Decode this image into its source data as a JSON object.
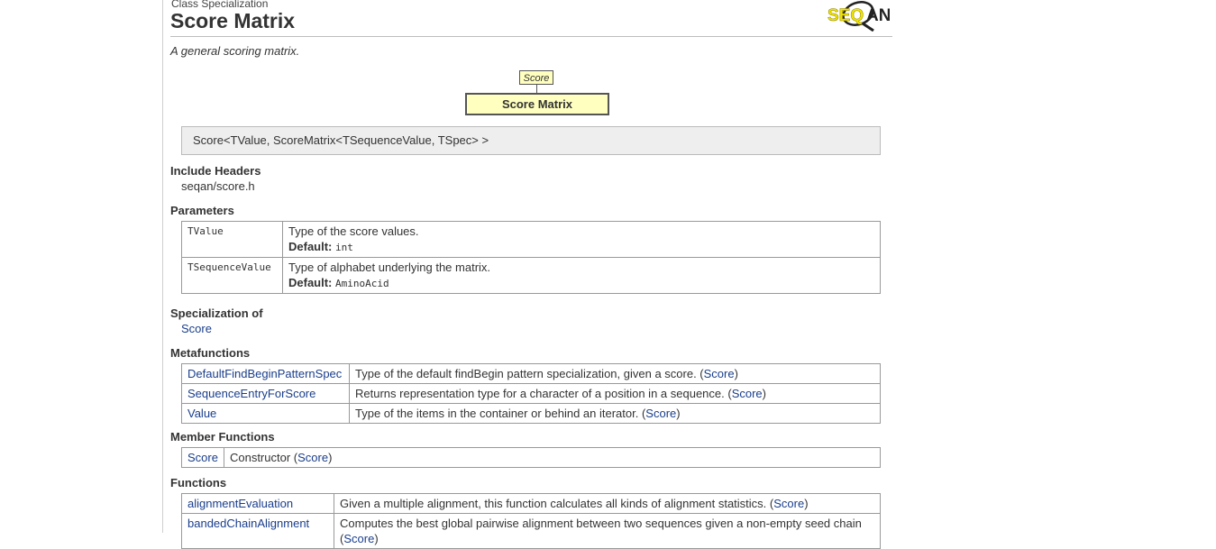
{
  "header": {
    "kind": "Class Specialization",
    "title": "Score Matrix",
    "logo_text": "SEQAN",
    "summary": "A general scoring matrix."
  },
  "diagram": {
    "parent": "Score",
    "current": "Score Matrix"
  },
  "signature": "Score<TValue, ScoreMatrix<TSequenceValue, TSpec> >",
  "include_headers": {
    "heading": "Include Headers",
    "items": [
      "seqan/score.h"
    ]
  },
  "parameters": {
    "heading": "Parameters",
    "default_label": "Default:",
    "rows": [
      {
        "name": "TValue",
        "desc": "Type of the score values.",
        "default": "int"
      },
      {
        "name": "TSequenceValue",
        "desc": "Type of alphabet underlying the matrix.",
        "default": "AminoAcid"
      }
    ]
  },
  "specialization_of": {
    "heading": "Specialization of",
    "link": "Score"
  },
  "metafunctions": {
    "heading": "Metafunctions",
    "rows": [
      {
        "name": "DefaultFindBeginPatternSpec",
        "desc": "Type of the default findBegin pattern specialization, given a score. (",
        "ref": "Score",
        "close": ")"
      },
      {
        "name": "SequenceEntryForScore",
        "desc": "Returns representation type for a character of a position in a sequence. (",
        "ref": "Score",
        "close": ")"
      },
      {
        "name": "Value",
        "desc": "Type of the items in the container or behind an iterator. (",
        "ref": "Score",
        "close": ")"
      }
    ]
  },
  "member_functions": {
    "heading": "Member Functions",
    "rows": [
      {
        "name": "Score",
        "desc": "Constructor (",
        "ref": "Score",
        "close": ")"
      }
    ]
  },
  "functions": {
    "heading": "Functions",
    "rows": [
      {
        "name": "alignmentEvaluation",
        "desc": "Given a multiple alignment, this function calculates all kinds of alignment statistics. (",
        "ref": "Score",
        "close": ")"
      },
      {
        "name": "bandedChainAlignment",
        "desc": "Computes the best global pairwise alignment between two sequences given a non-empty seed chain (",
        "ref": "Score",
        "close": ")"
      }
    ]
  },
  "colors": {
    "link": "#1a3e8c",
    "diagram_box": "#ffffbf",
    "signature_bg": "#eeeeee",
    "logo_yellow": "#f2e600"
  }
}
